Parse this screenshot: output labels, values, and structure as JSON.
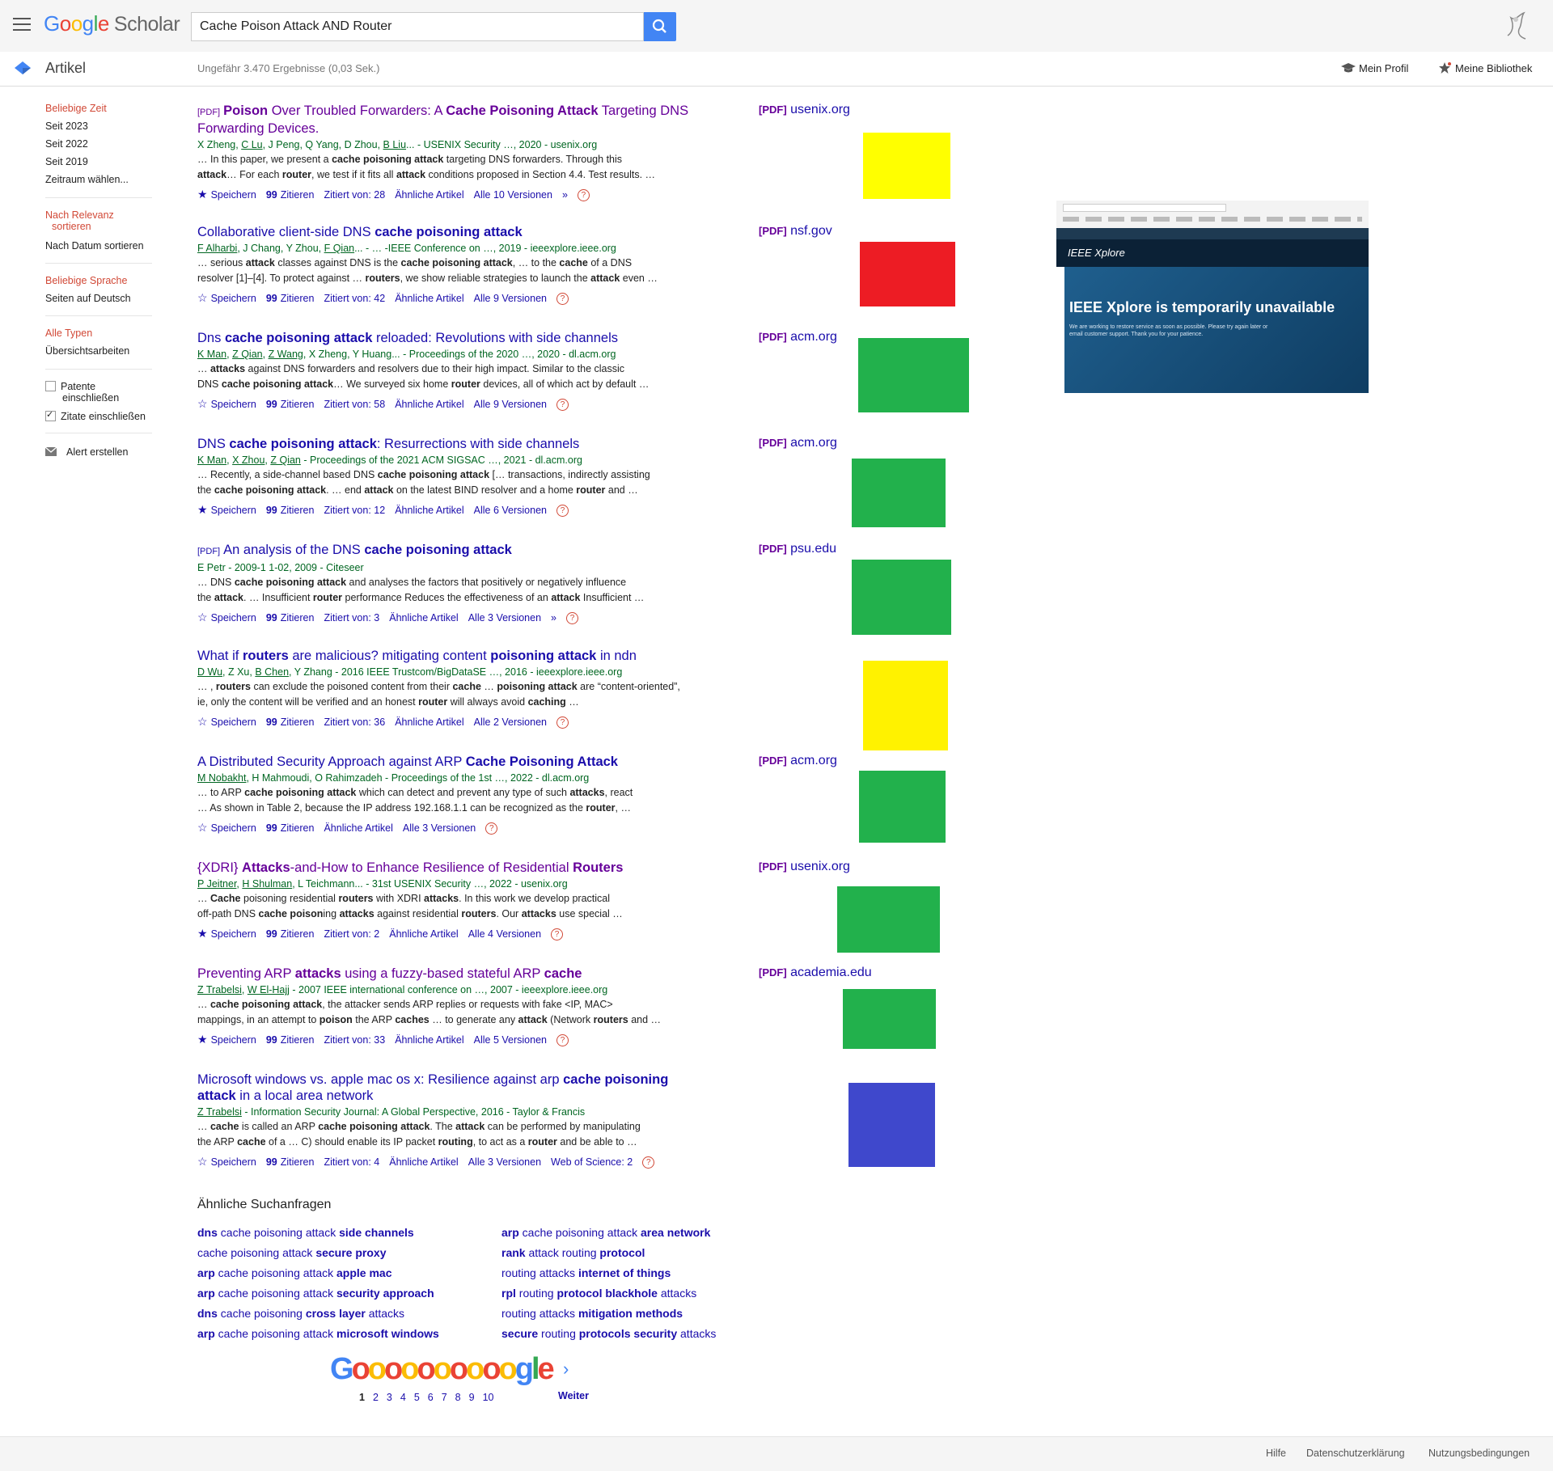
{
  "header": {
    "logo_google": "Google",
    "logo_scholar": "Scholar",
    "search_value": "Cache Poison Attack AND Router",
    "articles_label": "Artikel",
    "result_count": "Ungefähr 3.470 Ergebnisse (0,03 Sek.)",
    "profile_label": "Mein Profil",
    "library_label": "Meine Bibliothek"
  },
  "sidebar": {
    "any_time": "Beliebige Zeit",
    "since_2023": "Seit 2023",
    "since_2022": "Seit 2022",
    "since_2019": "Seit 2019",
    "custom_range": "Zeitraum wählen...",
    "sort_relevance_1": "Nach Relevanz",
    "sort_relevance_2": "sortieren",
    "sort_date": "Nach Datum sortieren",
    "any_language": "Beliebige Sprache",
    "german_pages": "Seiten auf Deutsch",
    "all_types": "Alle Typen",
    "review_articles": "Übersichtsarbeiten",
    "patents_1": "Patente",
    "patents_2": "einschließen",
    "citations": "Zitate einschließen",
    "create_alert": "Alert erstellen"
  },
  "link_labels": {
    "save": "Speichern",
    "cite": "Zitieren",
    "similar": "Ähnliche Artikel",
    "pdf": "[PDF]"
  },
  "results": [
    {
      "title_html": "<span class='pdf-tag'>[PDF]</span><b>Poison</b> Over Troubled Forwarders: A <b>Cache Poisoning Attack</b> Targeting DNS Forwarding Devices.",
      "visited": true,
      "authors_html": "X Zheng, <u>C Lu</u>, J Peng, Q Yang, D Zhou, <u>B Liu</u>... - USENIX Security …, 2020 - usenix.org",
      "snippet_html": "… In this paper, we present a <b>cache poisoning attack</b> targeting DNS forwarders. Through this<br><b>attack</b>… For each <b>router</b>, we test if it fits all <b>attack</b> conditions proposed in Section 4.4. Test results. …",
      "cited": "Zitiert von: 28",
      "versions": "Alle 10 Versionen",
      "saved": true,
      "more": true,
      "extra": "",
      "pdf_domain": "usenix.org",
      "swatch": "#ffff00"
    },
    {
      "title_html": "Collaborative client-side DNS <b>cache poisoning attack</b>",
      "visited": false,
      "authors_html": "<u>F Alharbi</u>, J Chang, Y Zhou, <u>F Qian</u>... - … -IEEE Conference on …, 2019 - ieeexplore.ieee.org",
      "snippet_html": "… serious <b>attack</b> classes against DNS is the <b>cache poisoning attack</b>, … to the <b>cache</b> of a DNS<br>resolver [1]–[4]. To protect against … <b>routers</b>, we show reliable strategies to launch the <b>attack</b> even …",
      "cited": "Zitiert von: 42",
      "versions": "Alle 9 Versionen",
      "saved": false,
      "more": false,
      "extra": "",
      "pdf_domain": "nsf.gov",
      "swatch": "#ed1c24"
    },
    {
      "title_html": "Dns <b>cache poisoning attack</b> reloaded: Revolutions with side channels",
      "visited": false,
      "authors_html": "<u>K Man</u>, <u>Z Qian</u>, <u>Z Wang</u>, X Zheng, Y Huang... - Proceedings of the 2020 …, 2020 - dl.acm.org",
      "snippet_html": "… <b>attacks</b> against DNS forwarders and resolvers due to their high impact. Similar to the classic<br>DNS <b>cache poisoning attack</b>… We surveyed six home <b>router</b> devices, all of which act by default …",
      "cited": "Zitiert von: 58",
      "versions": "Alle 9 Versionen",
      "saved": false,
      "more": false,
      "extra": "",
      "pdf_domain": "acm.org",
      "swatch": "#22b14c"
    },
    {
      "title_html": "DNS <b>cache poisoning attack</b>: Resurrections with side channels",
      "visited": false,
      "authors_html": "<u>K Man</u>, <u>X Zhou</u>, <u>Z Qian</u> - Proceedings of the 2021 ACM SIGSAC …, 2021 - dl.acm.org",
      "snippet_html": "… Recently, a side-channel based DNS <b>cache poisoning attack</b> [… transactions, indirectly assisting<br>the <b>cache poisoning attack</b>. … end <b>attack</b> on the latest BIND resolver and a home <b>router</b> and …",
      "cited": "Zitiert von: 12",
      "versions": "Alle 6 Versionen",
      "saved": true,
      "more": false,
      "extra": "",
      "pdf_domain": "acm.org",
      "swatch": "#22b14c"
    },
    {
      "title_html": "<span class='pdf-tag'>[PDF]</span>An analysis of the DNS <b>cache poisoning attack</b>",
      "visited": false,
      "authors_html": "E Petr - 2009-1 1-02, 2009 - Citeseer",
      "snippet_html": "… DNS <b>cache poisoning attack</b> and analyses the factors that positively or negatively influence<br>the <b>attack</b>. … Insufficient <b>router</b> performance Reduces the effectiveness of an <b>attack</b> Insufficient …",
      "cited": "Zitiert von: 3",
      "versions": "Alle 3 Versionen",
      "saved": false,
      "more": true,
      "extra": "",
      "pdf_domain": "psu.edu",
      "swatch": "#22b14c"
    },
    {
      "title_html": "What if <b>routers</b> are malicious? mitigating content <b>poisoning attack</b> in ndn",
      "visited": false,
      "authors_html": "<u>D Wu</u>, Z Xu, <u>B Chen</u>, Y Zhang - 2016 IEEE Trustcom/BigDataSE …, 2016 - ieeexplore.ieee.org",
      "snippet_html": "… , <b>routers</b> can exclude the poisoned content from their <b>cache</b> … <b>poisoning attack</b> are “content-oriented”,<br>ie, only the content will be verified and an honest <b>router</b> will always avoid <b>caching</b> …",
      "cited": "Zitiert von: 36",
      "versions": "Alle 2 Versionen",
      "saved": false,
      "more": false,
      "extra": "",
      "pdf_domain": "",
      "swatch": "#fff200"
    },
    {
      "title_html": "A Distributed Security Approach against ARP <b>Cache Poisoning Attack</b>",
      "visited": false,
      "authors_html": "<u>M Nobakht</u>, H Mahmoudi, O Rahimzadeh - Proceedings of the 1st …, 2022 - dl.acm.org",
      "snippet_html": "… to ARP <b>cache poisoning attack</b> which can detect and prevent any type of such <b>attacks</b>, react<br>… As shown in Table 2, because the IP address 192.168.1.1 can be recognized as the <b>router</b>, …",
      "cited": "",
      "versions": "Alle 3 Versionen",
      "saved": false,
      "more": false,
      "extra": "",
      "pdf_domain": "acm.org",
      "swatch": "#22b14c"
    },
    {
      "title_html": "{XDRI} <b>Attacks</b>-and-How to Enhance Resilience of Residential <b>Routers</b>",
      "visited": true,
      "authors_html": "<u>P Jeitner</u>, <u>H Shulman</u>, L Teichmann... - 31st USENIX Security …, 2022 - usenix.org",
      "snippet_html": "… <b>Cache</b> poisoning residential <b>routers</b> with XDRI <b>attacks</b>. In this work we develop practical<br>off-path DNS <b>cache poison</b>ing <b>attacks</b> against residential <b>routers</b>. Our <b>attacks</b> use special …",
      "cited": "Zitiert von: 2",
      "versions": "Alle 4 Versionen",
      "saved": true,
      "more": false,
      "extra": "",
      "pdf_domain": "usenix.org",
      "swatch": "#22b14c"
    },
    {
      "title_html": "Preventing ARP <b>attacks</b> using a fuzzy-based stateful ARP <b>cache</b>",
      "visited": true,
      "authors_html": "<u>Z Trabelsi</u>, <u>W El-Hajj</u> - 2007 IEEE international conference on …, 2007 - ieeexplore.ieee.org",
      "snippet_html": "… <b>cache poisoning attack</b>, the attacker sends ARP replies or requests with fake &lt;IP, MAC&gt;<br>mappings, in an attempt to <b>poison</b> the ARP <b>caches</b> … to generate any <b>attack</b> (Network <b>routers</b> and …",
      "cited": "Zitiert von: 33",
      "versions": "Alle 5 Versionen",
      "saved": true,
      "more": false,
      "extra": "",
      "pdf_domain": "academia.edu",
      "swatch": "#22b14c"
    },
    {
      "title_html": "Microsoft windows vs. apple mac os x: Resilience against arp <b>cache poisoning attack</b> in a local area network",
      "visited": false,
      "authors_html": "<u>Z Trabelsi</u> - Information Security Journal: A Global Perspective, 2016 - Taylor &amp; Francis",
      "snippet_html": "… <b>cache</b> is called an ARP <b>cache poisoning attack</b>. The <b>attack</b> can be performed by manipulating<br>the ARP <b>cache</b> of a … C) should enable its IP packet <b>routing</b>, to act as a <b>router</b> and be able to …",
      "cited": "Zitiert von: 4",
      "versions": "Alle 3 Versionen",
      "saved": false,
      "more": false,
      "extra": "Web of Science: 2",
      "pdf_domain": "",
      "swatch": "#3f48cc"
    }
  ],
  "ieee": {
    "brand": "IEEE Xplore",
    "headline": "IEEE Xplore is temporarily unavailable",
    "message": "We are working to restore service as soon as possible. Please try again later or email customer support. Thank you for your patience."
  },
  "related": {
    "title": "Ähnliche Suchanfragen",
    "left": [
      "<b>dns</b> cache poisoning attack <b>side channels</b>",
      "cache poisoning attack <b>secure proxy</b>",
      "<b>arp</b> cache poisoning attack <b>apple mac</b>",
      "<b>arp</b> cache poisoning attack <b>security approach</b>",
      "<b>dns</b> cache poisoning <b>cross layer</b> attacks",
      "<b>arp</b> cache poisoning attack <b>microsoft windows</b>"
    ],
    "right": [
      "<b>arp</b> cache poisoning attack <b>area network</b>",
      "<b>rank</b> attack routing <b>protocol</b>",
      "routing attacks <b>internet of things</b>",
      "<b>rpl</b> routing <b>protocol blackhole</b> attacks",
      "routing attacks <b>mitigation methods</b>",
      "<b>secure</b> routing <b>protocols security</b> attacks"
    ]
  },
  "pagination": {
    "pages": [
      "1",
      "2",
      "3",
      "4",
      "5",
      "6",
      "7",
      "8",
      "9",
      "10"
    ],
    "next": "Weiter"
  },
  "footer": {
    "help": "Hilfe",
    "privacy": "Datenschutzerklärung",
    "terms": "Nutzungsbedingungen"
  }
}
